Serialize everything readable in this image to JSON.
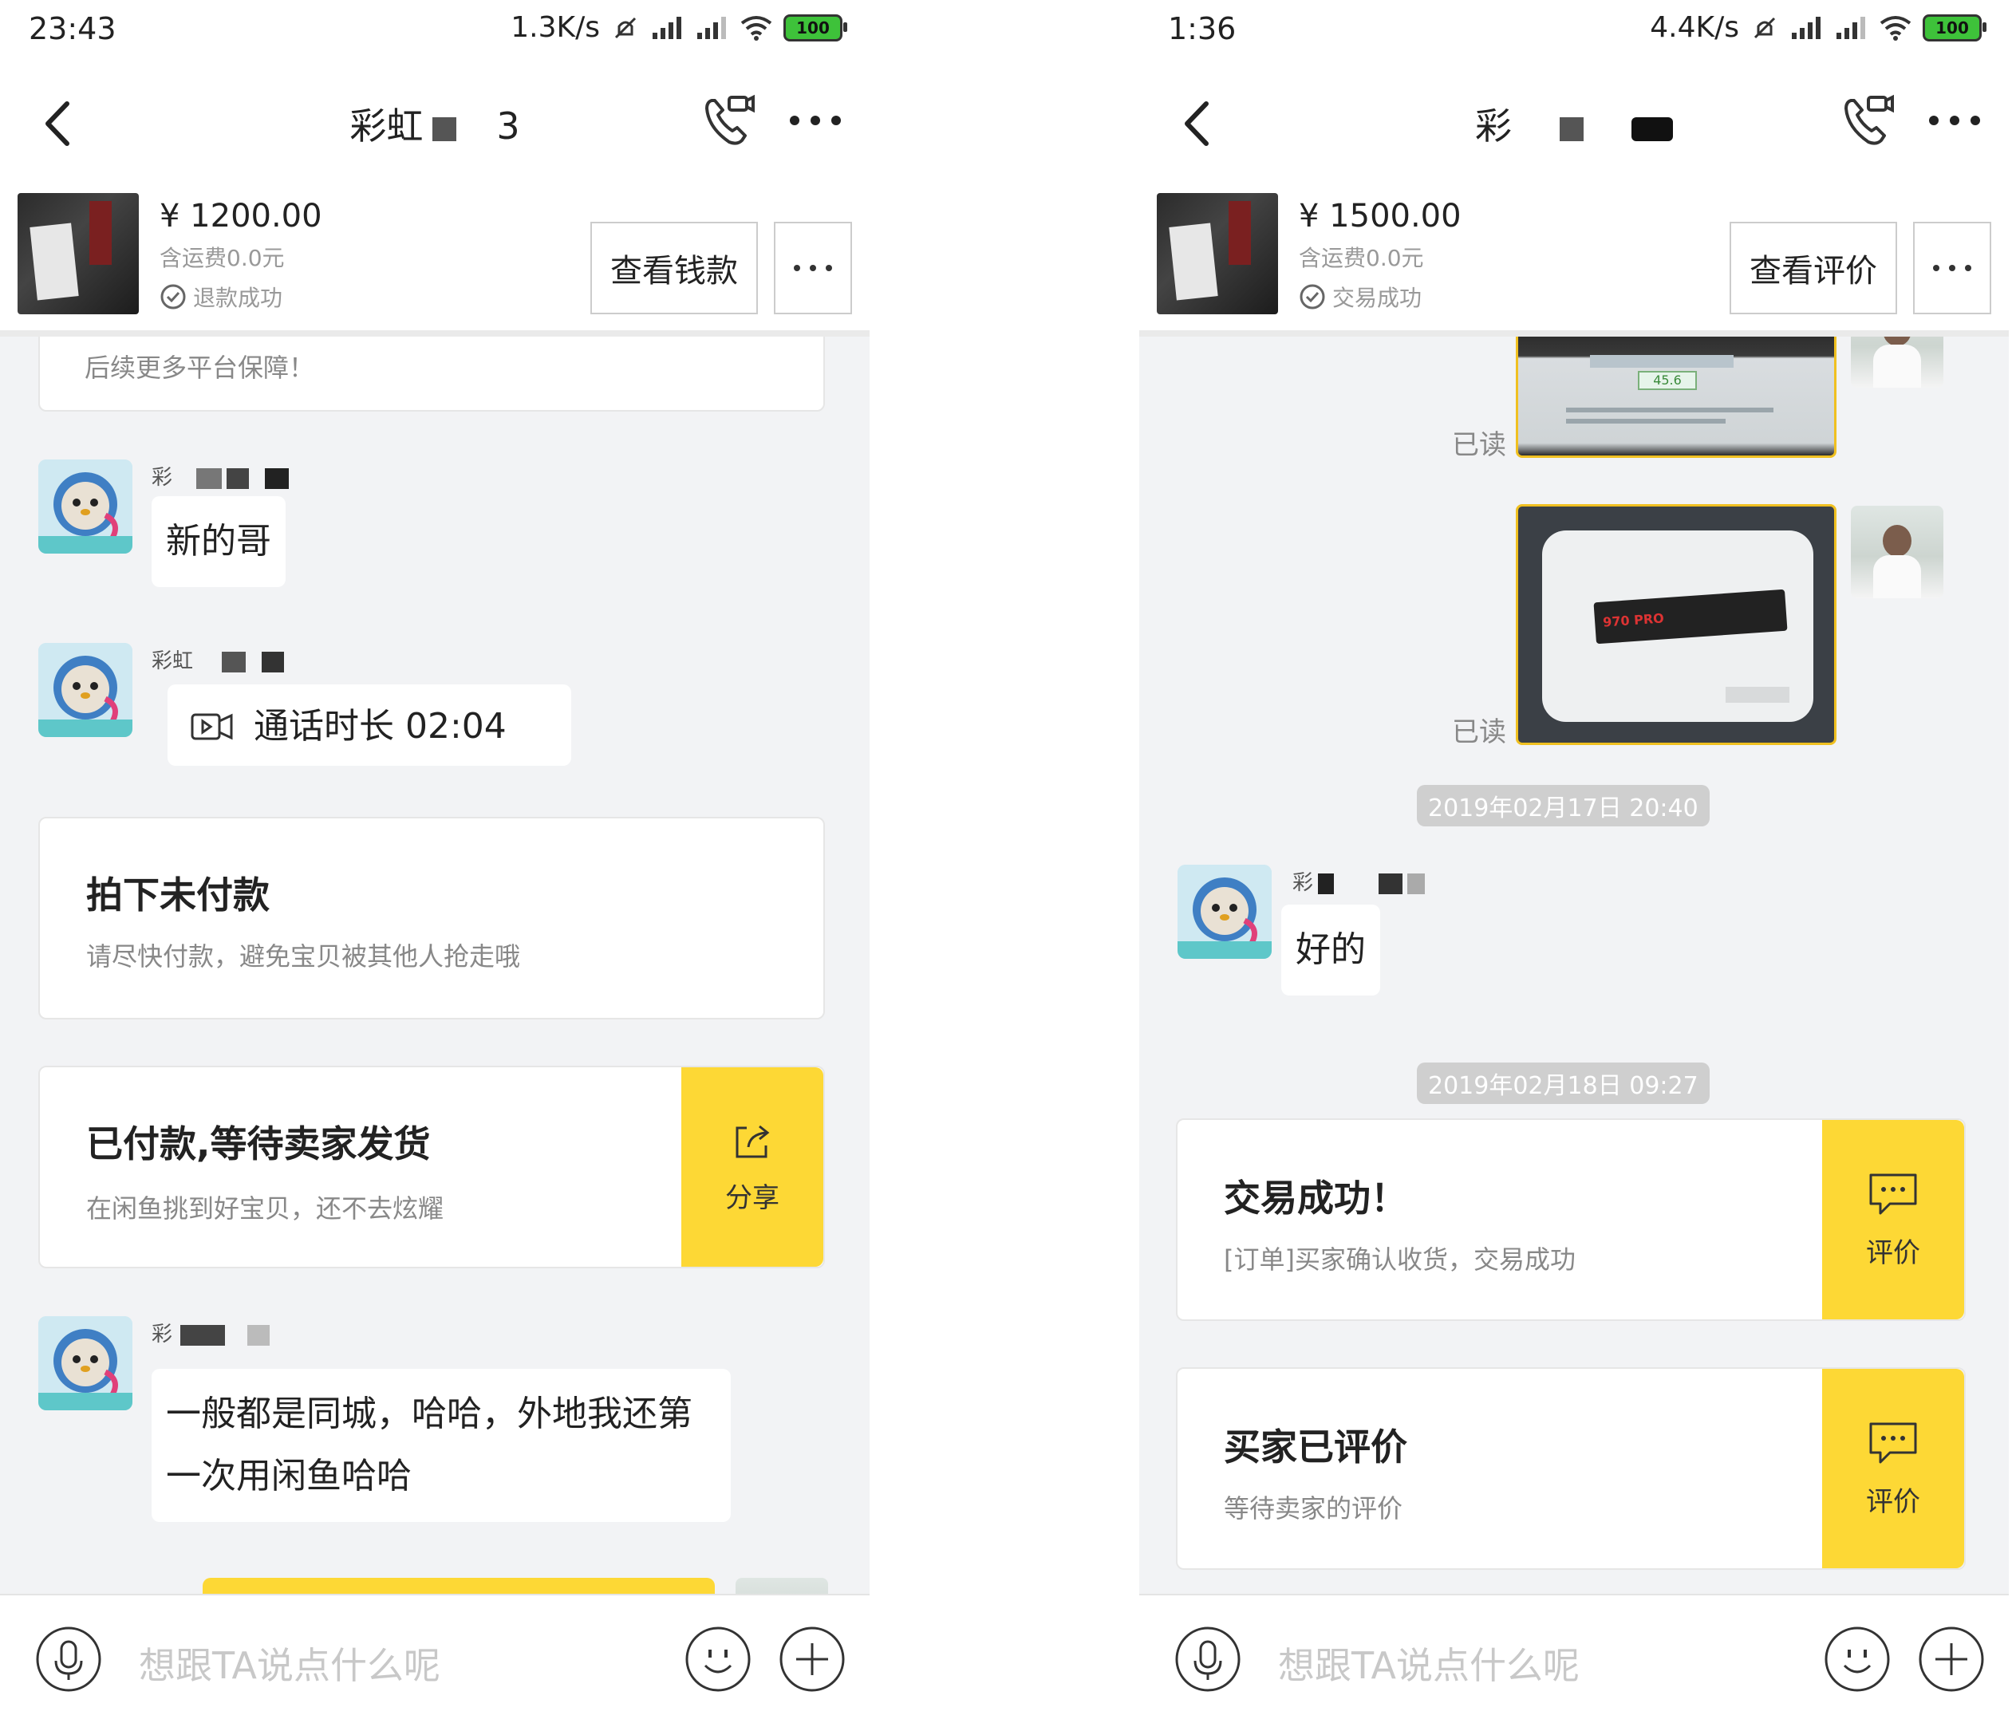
{
  "left": {
    "status": {
      "time": "23:43",
      "speed": "1.3K/s",
      "battery": "100"
    },
    "nav": {
      "title": "彩虹",
      "title_tail": "3"
    },
    "product": {
      "price": "¥ 1200.00",
      "shipping": "含运费0.0元",
      "status": "退款成功",
      "button": "查看钱款"
    },
    "messages": {
      "top_card_text": "后续更多平台保障！",
      "msg1_sender": "彩",
      "msg1_text": "新的哥",
      "msg2_sender": "彩虹",
      "msg2_call": "通话时长 02:04",
      "card1_title": "拍下未付款",
      "card1_sub": "请尽快付款，避免宝贝被其他人抢走哦",
      "card2_title": "已付款,等待卖家发货",
      "card2_sub": "在闲鱼挑到好宝贝，还不去炫耀",
      "card2_side": "分享",
      "msg3_sender": "彩",
      "msg3_text": "一般都是同城，哈哈，外地我还第一次用闲鱼哈哈"
    },
    "input": {
      "placeholder": "想跟TA说点什么呢"
    }
  },
  "right": {
    "status": {
      "time": "1:36",
      "speed": "4.4K/s",
      "battery": "100"
    },
    "nav": {
      "title": "彩"
    },
    "product": {
      "price": "¥ 1500.00",
      "shipping": "含运费0.0元",
      "status": "交易成功",
      "button": "查看评价"
    },
    "messages": {
      "read1": "已读",
      "photo1_value": "45.6",
      "read2": "已读",
      "photo2_label": "970 PRO",
      "ts1": "2019年02月17日 20:40",
      "msg1_sender": "彩",
      "msg1_text": "好的",
      "ts2": "2019年02月18日 09:27",
      "card1_title": "交易成功！",
      "card1_sub": "[订单]买家确认收货，交易成功",
      "card1_side": "评价",
      "card2_title": "买家已评价",
      "card2_sub": "等待卖家的评价",
      "card2_side": "评价"
    },
    "input": {
      "placeholder": "想跟TA说点什么呢"
    }
  }
}
